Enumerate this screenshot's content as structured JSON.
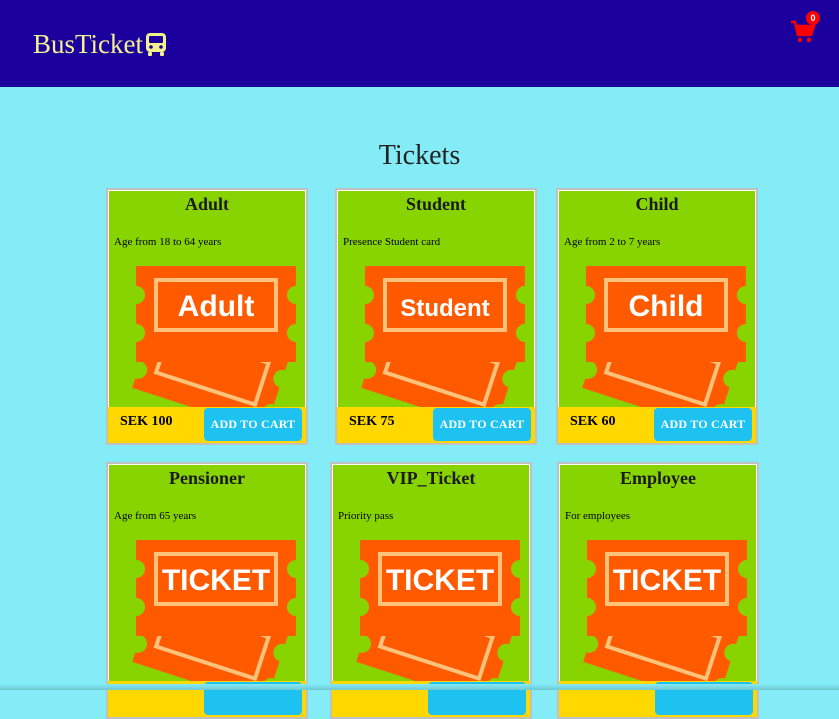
{
  "header": {
    "brand": "BusTicket",
    "brand_icon": "bus-icon",
    "cart_icon": "shopping-cart-icon",
    "cart_count": "0",
    "colors": {
      "navbar": "#1c009e",
      "brand": "#f2f28c",
      "cart": "#ff0000"
    }
  },
  "page": {
    "title": "Tickets",
    "background": "#84ecf7"
  },
  "tickets": [
    {
      "name": "Adult",
      "description": "Age from 18 to 64 years",
      "image_text": "Adult",
      "price": "SEK 100",
      "button": "ADD TO CART"
    },
    {
      "name": "Student",
      "description": "Presence Student card",
      "image_text": "Student",
      "price": "SEK 75",
      "button": "ADD TO CART"
    },
    {
      "name": "Child",
      "description": "Age from 2 to 7 years",
      "image_text": "Child",
      "price": "SEK 60",
      "button": "ADD TO CART"
    },
    {
      "name": "Pensioner",
      "description": "Age from 65 years",
      "image_text": "TICKET",
      "price": "",
      "button": ""
    },
    {
      "name": "VIP_Ticket",
      "description": "Priority pass",
      "image_text": "TICKET",
      "price": "",
      "button": ""
    },
    {
      "name": "Employee",
      "description": "For employees",
      "image_text": "TICKET",
      "price": "",
      "button": ""
    }
  ],
  "colors": {
    "card": "#88d400",
    "footer": "#ffd800",
    "button": "#1ec2f0",
    "ticket": "#ff5a00"
  }
}
